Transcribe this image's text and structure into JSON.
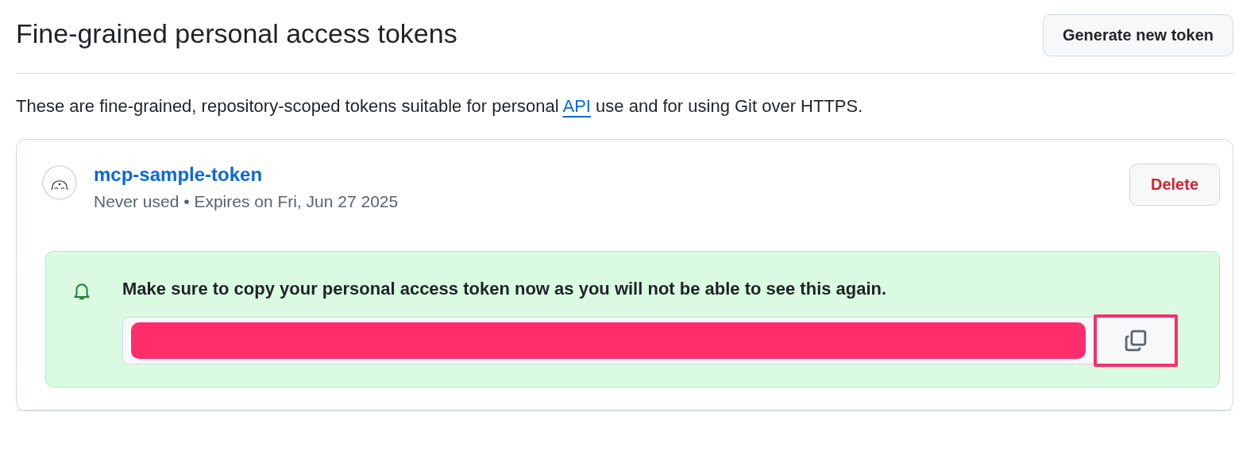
{
  "header": {
    "title": "Fine-grained personal access tokens",
    "button": "Generate new token"
  },
  "description": {
    "before": "These are fine-grained, repository-scoped tokens suitable for personal ",
    "link": "API",
    "after": " use and for using Git over HTTPS."
  },
  "token": {
    "name": "mcp-sample-token",
    "meta": "Never used • Expires on Fri, Jun 27 2025",
    "delete_button": "Delete",
    "notice": {
      "message": "Make sure to copy your personal access token now as you will not be able to see this again.",
      "value_redacted": true,
      "copy_button_highlighted": true
    }
  }
}
